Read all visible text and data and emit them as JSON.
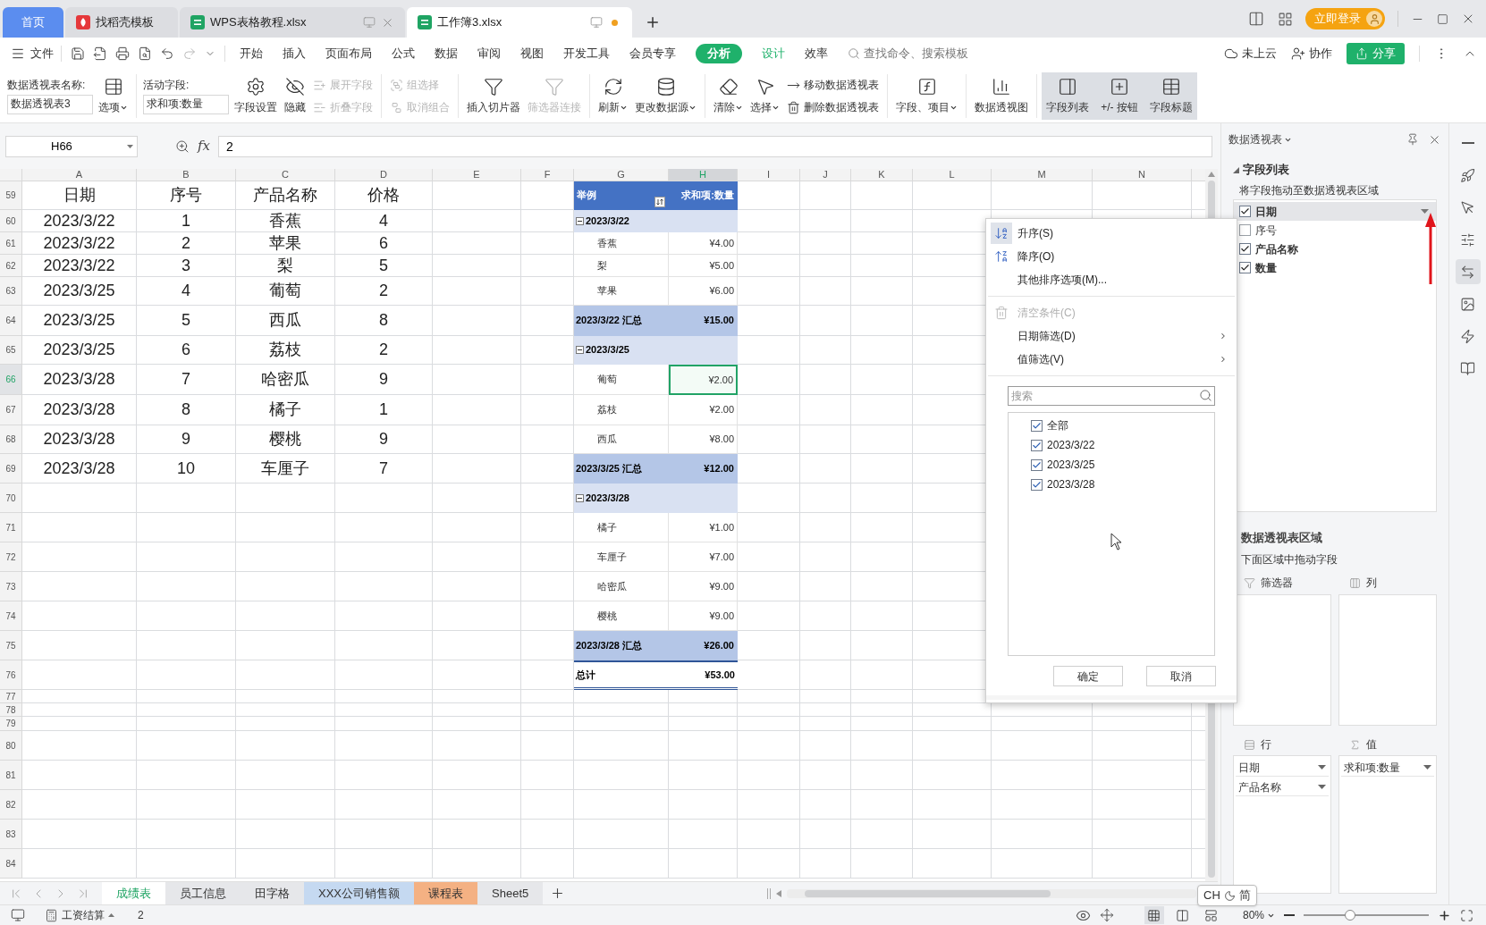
{
  "title_bar": {
    "tabs": [
      {
        "label": "首页",
        "kind": "home",
        "selected": false
      },
      {
        "label": "找稻壳模板",
        "kind": "docer",
        "selected": false
      },
      {
        "label": "WPS表格教程.xlsx",
        "kind": "sheet",
        "selected": false,
        "unsaved": false
      },
      {
        "label": "工作簿3.xlsx",
        "kind": "sheet",
        "selected": true,
        "unsaved": true
      }
    ],
    "login": "立即登录"
  },
  "menu": {
    "file": "文件",
    "tabs": [
      {
        "label": "开始",
        "kind": "standard",
        "selected": false
      },
      {
        "label": "插入",
        "kind": "standard",
        "selected": false
      },
      {
        "label": "页面布局",
        "kind": "standard",
        "selected": false
      },
      {
        "label": "公式",
        "kind": "standard",
        "selected": false
      },
      {
        "label": "数据",
        "kind": "standard",
        "selected": false
      },
      {
        "label": "审阅",
        "kind": "standard",
        "selected": false
      },
      {
        "label": "视图",
        "kind": "standard",
        "selected": false
      },
      {
        "label": "开发工具",
        "kind": "standard",
        "selected": false
      },
      {
        "label": "会员专享",
        "kind": "standard",
        "selected": false
      },
      {
        "label": "分析",
        "kind": "contextual",
        "selected": true
      },
      {
        "label": "设计",
        "kind": "contextual",
        "selected": false
      },
      {
        "label": "效率",
        "kind": "standard",
        "selected": false
      }
    ],
    "search": {
      "placeholder": "查找命令、搜索模板"
    },
    "cloud": "未上云",
    "collab": "协作",
    "share": "分享"
  },
  "ribbon": {
    "items": [
      {
        "kind": "field",
        "label": "数据透视表名称:",
        "value": "数据透视表3"
      },
      {
        "kind": "large",
        "label": "选项",
        "dropdown": true,
        "disabled": false
      },
      {
        "kind": "separator"
      },
      {
        "kind": "field",
        "label": "活动字段:",
        "value": "求和项:数量"
      },
      {
        "kind": "large",
        "label": "字段设置",
        "dropdown": false,
        "disabled": false
      },
      {
        "kind": "large",
        "label": "隐藏",
        "dropdown": false,
        "disabled": false
      },
      {
        "kind": "pair",
        "items": [
          {
            "label": "展开字段",
            "disabled": true
          },
          {
            "label": "折叠字段",
            "disabled": true
          }
        ]
      },
      {
        "kind": "separator"
      },
      {
        "kind": "pair",
        "items": [
          {
            "label": "组选择",
            "disabled": true
          },
          {
            "label": "取消组合",
            "disabled": true
          }
        ]
      },
      {
        "kind": "separator"
      },
      {
        "kind": "large",
        "label": "插入切片器",
        "dropdown": false,
        "disabled": false
      },
      {
        "kind": "large",
        "label": "筛选器连接",
        "dropdown": false,
        "disabled": true
      },
      {
        "kind": "separator"
      },
      {
        "kind": "large",
        "label": "刷新",
        "dropdown": true,
        "disabled": false
      },
      {
        "kind": "large",
        "label": "更改数据源",
        "dropdown": true,
        "disabled": false
      },
      {
        "kind": "separator"
      },
      {
        "kind": "large",
        "label": "清除",
        "dropdown": true,
        "disabled": false
      },
      {
        "kind": "large",
        "label": "选择",
        "dropdown": true,
        "disabled": false
      },
      {
        "kind": "pair",
        "items": [
          {
            "label": "移动数据透视表",
            "disabled": false
          },
          {
            "label": "删除数据透视表",
            "disabled": false
          }
        ]
      },
      {
        "kind": "separator"
      },
      {
        "kind": "large",
        "label": "字段、项目",
        "dropdown": true,
        "disabled": false
      },
      {
        "kind": "separator"
      },
      {
        "kind": "large",
        "label": "数据透视图",
        "dropdown": false,
        "disabled": false
      },
      {
        "kind": "separator"
      },
      {
        "kind": "toggle",
        "label": "字段列表",
        "on": true
      },
      {
        "kind": "toggle",
        "label": "+/- 按钮",
        "on": true
      },
      {
        "kind": "toggle",
        "label": "字段标题",
        "on": true
      }
    ]
  },
  "formula_bar": {
    "cell": "H66",
    "function_label": "fx",
    "value": "2"
  },
  "grid": {
    "columns": [
      {
        "label": "A",
        "selected": false
      },
      {
        "label": "B",
        "selected": false
      },
      {
        "label": "C",
        "selected": false
      },
      {
        "label": "D",
        "selected": false
      },
      {
        "label": "E",
        "selected": false
      },
      {
        "label": "F",
        "selected": false
      },
      {
        "label": "G",
        "selected": false
      },
      {
        "label": "H",
        "selected": true
      },
      {
        "label": "I",
        "selected": false
      },
      {
        "label": "J",
        "selected": false
      },
      {
        "label": "K",
        "selected": false
      },
      {
        "label": "L",
        "selected": false
      },
      {
        "label": "M",
        "selected": false
      },
      {
        "label": "N",
        "selected": false
      }
    ],
    "rows": [
      {
        "number": "59",
        "selected": false,
        "cells": [
          "日期",
          "序号",
          "产品名称",
          "价格"
        ],
        "pivot": {
          "kind": "header",
          "label": "举例",
          "value": "求和项:数量"
        }
      },
      {
        "number": "60",
        "selected": false,
        "cells": [
          "2023/3/22",
          "1",
          "香蕉",
          "4"
        ],
        "pivot": {
          "kind": "group",
          "label": "2023/3/22"
        }
      },
      {
        "number": "61",
        "selected": false,
        "cells": [
          "2023/3/22",
          "2",
          "苹果",
          "6"
        ],
        "pivot": {
          "kind": "item",
          "label": "香蕉",
          "value": "¥4.00",
          "selected": false
        }
      },
      {
        "number": "62",
        "selected": false,
        "cells": [
          "2023/3/22",
          "3",
          "梨",
          "5"
        ],
        "pivot": {
          "kind": "item",
          "label": "梨",
          "value": "¥5.00",
          "selected": false
        }
      },
      {
        "number": "63",
        "selected": false,
        "cells": [
          "2023/3/25",
          "4",
          "葡萄",
          "2"
        ],
        "pivot": {
          "kind": "item",
          "label": "苹果",
          "value": "¥6.00",
          "selected": false
        }
      },
      {
        "number": "64",
        "selected": false,
        "cells": [
          "2023/3/25",
          "5",
          "西瓜",
          "8"
        ],
        "pivot": {
          "kind": "subtotal",
          "label": "2023/3/22 汇总",
          "value": "¥15.00"
        }
      },
      {
        "number": "65",
        "selected": false,
        "cells": [
          "2023/3/25",
          "6",
          "荔枝",
          "2"
        ],
        "pivot": {
          "kind": "group",
          "label": "2023/3/25"
        }
      },
      {
        "number": "66",
        "selected": true,
        "cells": [
          "2023/3/28",
          "7",
          "哈密瓜",
          "9"
        ],
        "pivot": {
          "kind": "item",
          "label": "葡萄",
          "value": "¥2.00",
          "selected": true
        }
      },
      {
        "number": "67",
        "selected": false,
        "cells": [
          "2023/3/28",
          "8",
          "橘子",
          "1"
        ],
        "pivot": {
          "kind": "item",
          "label": "荔枝",
          "value": "¥2.00",
          "selected": false
        }
      },
      {
        "number": "68",
        "selected": false,
        "cells": [
          "2023/3/28",
          "9",
          "樱桃",
          "9"
        ],
        "pivot": {
          "kind": "item",
          "label": "西瓜",
          "value": "¥8.00",
          "selected": false
        }
      },
      {
        "number": "69",
        "selected": false,
        "cells": [
          "2023/3/28",
          "10",
          "车厘子",
          "7"
        ],
        "pivot": {
          "kind": "subtotal",
          "label": "2023/3/25 汇总",
          "value": "¥12.00"
        }
      },
      {
        "number": "70",
        "selected": false,
        "pivot": {
          "kind": "group",
          "label": "2023/3/28"
        }
      },
      {
        "number": "71",
        "selected": false,
        "pivot": {
          "kind": "item",
          "label": "橘子",
          "value": "¥1.00",
          "selected": false
        }
      },
      {
        "number": "72",
        "selected": false,
        "pivot": {
          "kind": "item",
          "label": "车厘子",
          "value": "¥7.00",
          "selected": false
        }
      },
      {
        "number": "73",
        "selected": false,
        "pivot": {
          "kind": "item",
          "label": "哈密瓜",
          "value": "¥9.00",
          "selected": false
        }
      },
      {
        "number": "74",
        "selected": false,
        "pivot": {
          "kind": "item",
          "label": "樱桃",
          "value": "¥9.00",
          "selected": false
        }
      },
      {
        "number": "75",
        "selected": false,
        "pivot": {
          "kind": "subtotal",
          "label": "2023/3/28 汇总",
          "value": "¥26.00"
        }
      },
      {
        "number": "76",
        "selected": false,
        "pivot": {
          "kind": "total",
          "label": "总计",
          "value": "¥53.00"
        }
      },
      {
        "number": "77",
        "selected": false
      },
      {
        "number": "78",
        "selected": false
      },
      {
        "number": "79",
        "selected": false
      },
      {
        "number": "80",
        "selected": false
      },
      {
        "number": "81",
        "selected": false
      },
      {
        "number": "82",
        "selected": false
      },
      {
        "number": "83",
        "selected": false
      },
      {
        "number": "84",
        "selected": false
      }
    ]
  },
  "filter_menu": {
    "items": [
      {
        "kind": "icon_action",
        "label": "升序(S)",
        "disabled": false,
        "selected": true
      },
      {
        "kind": "icon_action",
        "label": "降序(O)",
        "disabled": false,
        "selected": false
      },
      {
        "kind": "action",
        "label": "其他排序选项(M)...",
        "disabled": false,
        "selected": false
      },
      {
        "kind": "separator"
      },
      {
        "kind": "icon_action",
        "label": "清空条件(C)",
        "disabled": true,
        "selected": false
      },
      {
        "kind": "submenu",
        "label": "日期筛选(D)",
        "disabled": false,
        "selected": false
      },
      {
        "kind": "submenu",
        "label": "值筛选(V)",
        "disabled": false,
        "selected": false
      }
    ],
    "search": {
      "placeholder": "搜索"
    },
    "values": [
      {
        "label": "全部",
        "checked": true
      },
      {
        "label": "2023/3/22",
        "checked": true
      },
      {
        "label": "2023/3/25",
        "checked": true
      },
      {
        "label": "2023/3/28",
        "checked": true
      }
    ],
    "buttons": [
      "确定",
      "取消"
    ]
  },
  "pivot_panel": {
    "title": "数据透视表",
    "field_list": {
      "title": "字段列表",
      "hint": "将字段拖动至数据透视表区域",
      "fields": [
        {
          "label": "日期",
          "checked": true,
          "selected": true
        },
        {
          "label": "序号",
          "checked": false,
          "selected": false
        },
        {
          "label": "产品名称",
          "checked": true,
          "selected": false
        },
        {
          "label": "数量",
          "checked": true,
          "selected": false
        }
      ]
    },
    "areas": {
      "title": "数据透视表区域",
      "hint": "下面区域中拖动字段",
      "sections": [
        {
          "kind": "filter",
          "label": "筛选器"
        },
        {
          "kind": "column",
          "label": "列"
        },
        {
          "kind": "row",
          "label": "行",
          "fields": [
            "日期",
            "产品名称"
          ]
        },
        {
          "kind": "value",
          "label": "值",
          "fields": [
            "求和项:数量"
          ]
        }
      ]
    }
  },
  "side_tools": [
    {
      "selected": false
    },
    {
      "selected": false
    },
    {
      "selected": false
    },
    {
      "selected": false
    },
    {
      "selected": true
    },
    {
      "selected": false
    },
    {
      "selected": false
    },
    {
      "selected": false
    }
  ],
  "sheet_tabs": [
    {
      "label": "成绩表",
      "selected": true
    },
    {
      "label": "员工信息",
      "selected": false
    },
    {
      "label": "田字格",
      "selected": false
    },
    {
      "label": "XXX公司销售额",
      "selected": false,
      "color": "#c5d9f1"
    },
    {
      "label": "课程表",
      "selected": false,
      "color": "#f4b183"
    },
    {
      "label": "Sheet5",
      "selected": false
    }
  ],
  "ime_tooltip": {
    "lang": "CH",
    "mode": "简"
  },
  "status_bar": {
    "macro": "工资结算",
    "value": "2",
    "views": [
      {
        "selected": true
      },
      {
        "selected": false
      },
      {
        "selected": false
      }
    ],
    "zoom": "80%",
    "zoom_slider": {
      "level": 0.37
    }
  }
}
